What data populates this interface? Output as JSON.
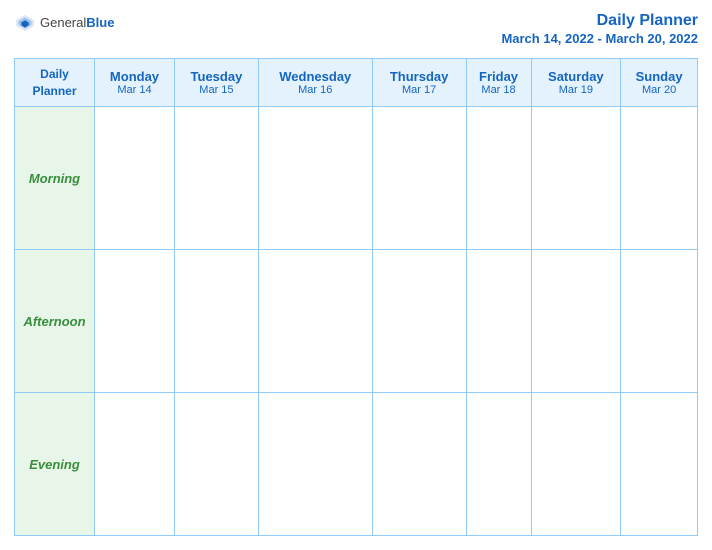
{
  "logo": {
    "general": "General",
    "blue": "Blue"
  },
  "header": {
    "title": "Daily Planner",
    "date_range": "March 14, 2022 - March 20, 2022"
  },
  "table": {
    "first_col_line1": "Daily",
    "first_col_line2": "Planner",
    "days": [
      {
        "name": "Monday",
        "date": "Mar 14"
      },
      {
        "name": "Tuesday",
        "date": "Mar 15"
      },
      {
        "name": "Wednesday",
        "date": "Mar 16"
      },
      {
        "name": "Thursday",
        "date": "Mar 17"
      },
      {
        "name": "Friday",
        "date": "Mar 18"
      },
      {
        "name": "Saturday",
        "date": "Mar 19"
      },
      {
        "name": "Sunday",
        "date": "Mar 20"
      }
    ],
    "rows": [
      {
        "label": "Morning"
      },
      {
        "label": "Afternoon"
      },
      {
        "label": "Evening"
      }
    ]
  }
}
